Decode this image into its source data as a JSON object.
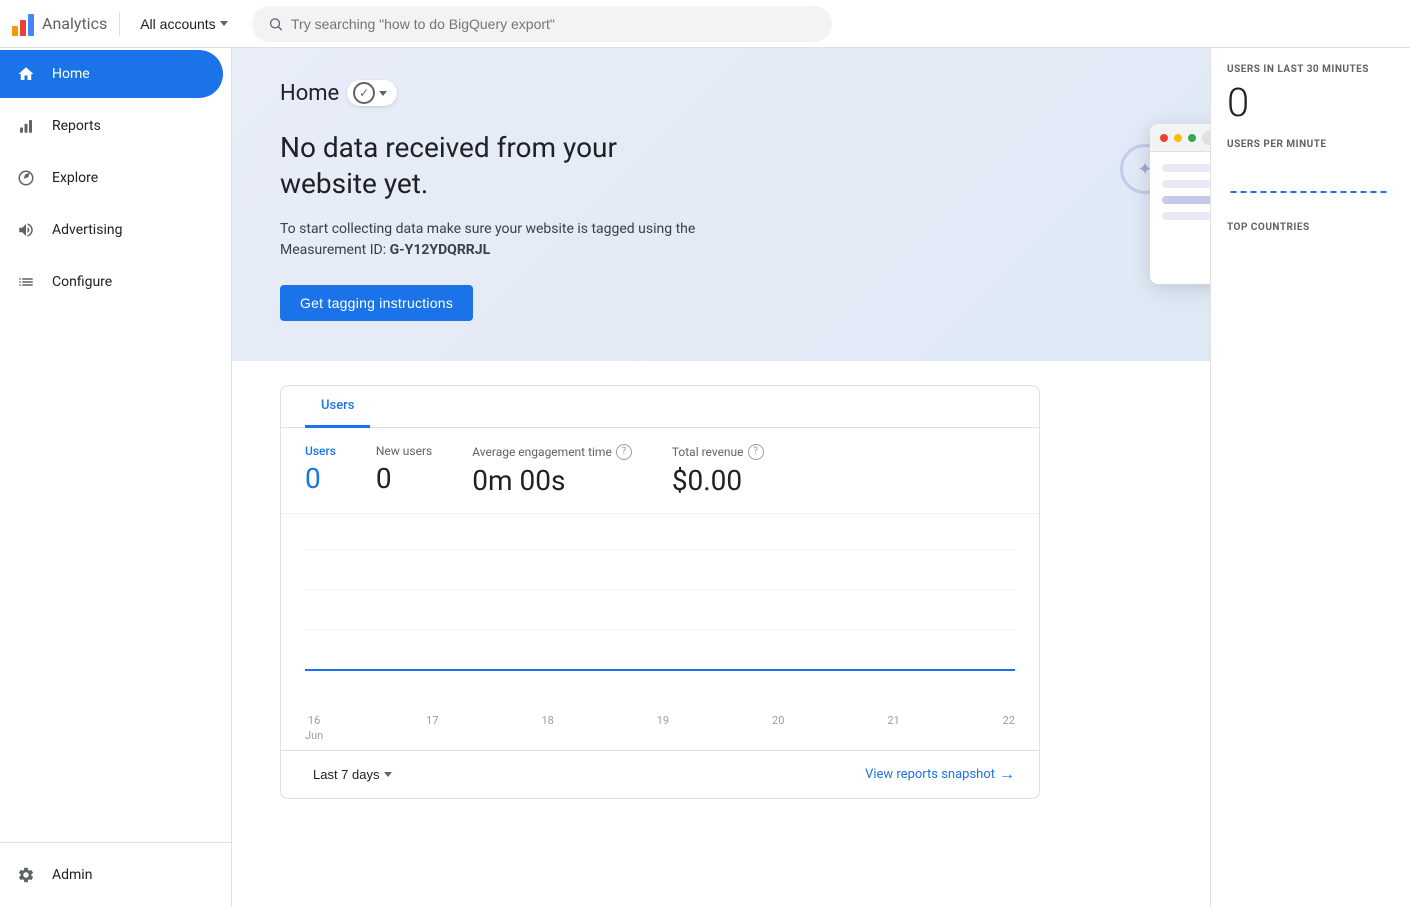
{
  "app": {
    "name": "Analytics",
    "account": "All accounts",
    "search_placeholder": "Try searching \"how to do BigQuery export\""
  },
  "sidebar": {
    "items": [
      {
        "id": "home",
        "label": "Home",
        "icon": "home",
        "active": true
      },
      {
        "id": "reports",
        "label": "Reports",
        "icon": "bar-chart",
        "active": false
      },
      {
        "id": "explore",
        "label": "Explore",
        "icon": "explore",
        "active": false
      },
      {
        "id": "advertising",
        "label": "Advertising",
        "icon": "advertising",
        "active": false
      },
      {
        "id": "configure",
        "label": "Configure",
        "icon": "configure",
        "active": false
      }
    ],
    "admin_label": "Admin"
  },
  "hero": {
    "title": "Home",
    "no_data_heading": "No data received from your website yet.",
    "description": "To start collecting data make sure your website is tagged using the Measurement ID:",
    "measurement_id": "G-Y12YDQRRJL",
    "cta_button": "Get tagging instructions"
  },
  "chart": {
    "tabs": [
      "Users"
    ],
    "metrics": [
      {
        "id": "users",
        "label": "Users",
        "value": "0",
        "active": true
      },
      {
        "id": "new_users",
        "label": "New users",
        "value": "0",
        "active": false
      },
      {
        "id": "avg_engagement",
        "label": "Average engagement time",
        "value": "0m 00s",
        "has_help": true,
        "active": false
      },
      {
        "id": "total_revenue",
        "label": "Total revenue",
        "value": "$0.00",
        "has_help": true,
        "active": false
      }
    ],
    "x_axis_labels": [
      "16\nJun",
      "17",
      "18",
      "19",
      "20",
      "21",
      "22"
    ],
    "date_range": "Last 7 days",
    "view_reports_link": "View reports snapshot"
  },
  "realtime": {
    "users_30_min_label": "USERS IN LAST 30 MINUTES",
    "users_30_min_value": "0",
    "users_per_minute_label": "USERS PER MINUTE",
    "top_countries_label": "TOP COUNTRIES"
  }
}
